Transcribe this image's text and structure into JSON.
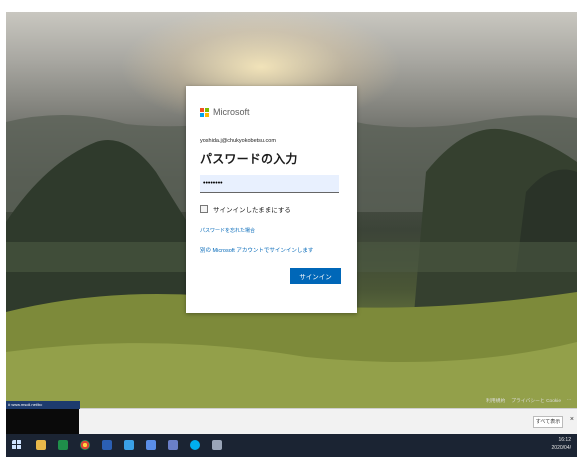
{
  "dialog": {
    "brand": "Microsoft",
    "email": "yoshida.j@chukyokobetsu.com",
    "heading": "パスワードの入力",
    "password_value": "••••••••",
    "keep_signed_in": "サインインしたままにする",
    "forgot_password": "パスワードを忘れた場合",
    "other_account": "別の Microsoft アカウントでサインインします",
    "signin_button": "サインイン"
  },
  "footer_links": {
    "terms": "利用規約",
    "privacy": "プライバシーと Cookie",
    "more": "..."
  },
  "download_bar": {
    "item_title": "# www.msoli.net/bc",
    "show_all": "すべて表示",
    "close": "×"
  },
  "taskbar": {
    "time": "16:12",
    "date": "2020/04/"
  },
  "colors": {
    "accent": "#0067b8",
    "ms_red": "#f25022",
    "ms_green": "#7fba00",
    "ms_blue": "#00a4ef",
    "ms_yellow": "#ffb900"
  }
}
